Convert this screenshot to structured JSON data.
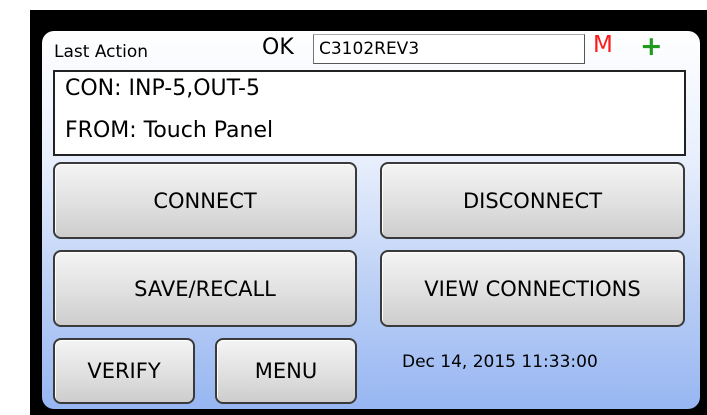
{
  "header": {
    "last_action_label": "Last Action",
    "status": "OK",
    "fw_version": "C3102REV3",
    "m_indicator": "M",
    "plus_indicator": "+",
    "colors": {
      "m_indicator": "#ff1a1a",
      "plus_indicator": "#1e9b1e"
    }
  },
  "message": {
    "line1": "CON: INP-5,OUT-5",
    "line2": "FROM: Touch Panel"
  },
  "buttons": {
    "connect": "CONNECT",
    "disconnect": "DISCONNECT",
    "save_recall": "SAVE/RECALL",
    "view_connections": "VIEW CONNECTIONS",
    "verify": "VERIFY",
    "menu": "MENU"
  },
  "footer": {
    "datetime": "Dec 14, 2015 11:33:00"
  }
}
